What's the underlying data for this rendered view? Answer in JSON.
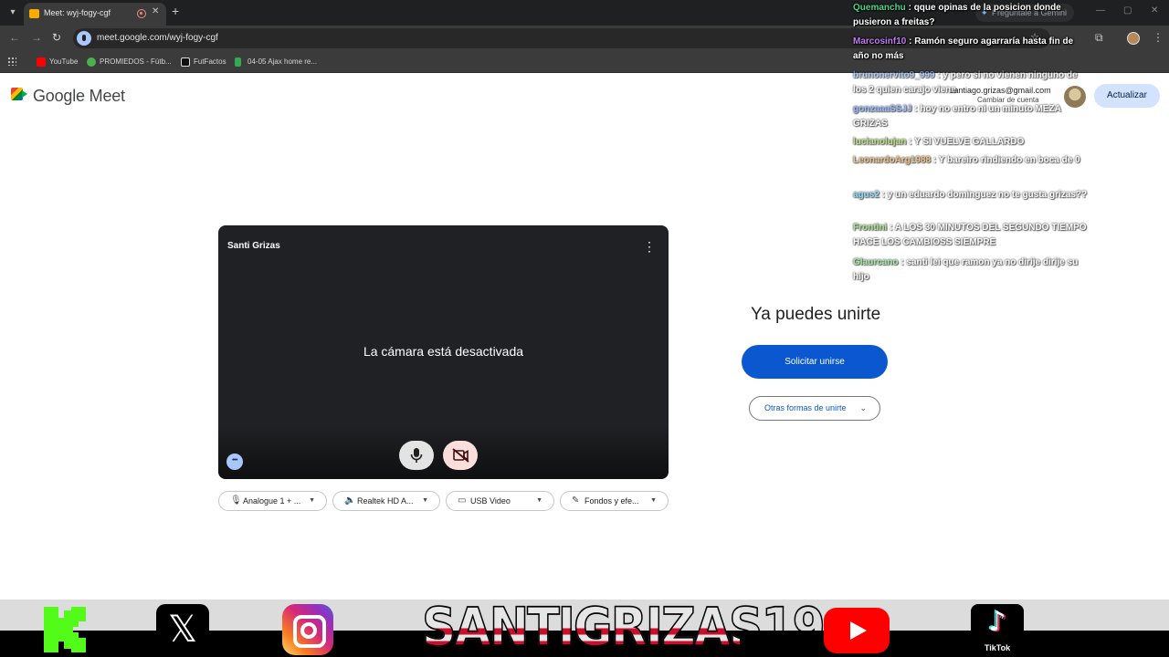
{
  "browser": {
    "tab_title": "Meet: wyj-fogy-cgf",
    "url": "meet.google.com/wyj-fogy-cgf",
    "profile_chip": "Pregúntale a Gemini",
    "bookmarks": [
      {
        "label": "YouTube",
        "color": "#ff0000"
      },
      {
        "label": "PROMIEDOS - Fútb...",
        "color": "#4caf50"
      },
      {
        "label": "FutFactos",
        "color": "#ffffff"
      },
      {
        "label": "04-05 Ajax home re...",
        "color": "#34a853"
      }
    ]
  },
  "header": {
    "brand": "Google Meet",
    "account_email": "santiago.grizas@gmail.com",
    "switch_account": "Cambiar de cuenta",
    "update_button": "Actualizar"
  },
  "preview": {
    "participant_name": "Santi Grizas",
    "camera_status": "La cámara está desactivada",
    "devices": [
      {
        "icon": "microphone-icon",
        "glyph": "🎙",
        "label": "Analogue 1 + ..."
      },
      {
        "icon": "speaker-icon",
        "glyph": "🔈",
        "label": "Realtek HD A..."
      },
      {
        "icon": "video-camera-icon",
        "glyph": "▭",
        "label": "USB Video"
      },
      {
        "icon": "effects-icon",
        "glyph": "✎",
        "label": "Fondos y efe..."
      }
    ]
  },
  "join_panel": {
    "title": "Ya puedes unirte",
    "join_button": "Solicitar unirse",
    "other_ways_button": "Otras formas de unirte"
  },
  "chat": {
    "messages": [
      {
        "user": "Quemanchu",
        "color": "#4dd68a",
        "text": "qque opinas de la posicion donde pusieron a freitas?",
        "faded": false
      },
      {
        "user": "Marcosinf10",
        "color": "#c27cf5",
        "text": "Ramón seguro agarraría hasta fin de año no más",
        "faded": false
      },
      {
        "user": "brunonervito9_999",
        "color": "#8ab4f8",
        "text": "y pero si no vienen ninguno de los 2 quien carajo viene",
        "faded": true
      },
      {
        "user": "gonzaaaSSJJ",
        "color": "#5b8cff",
        "text": "hoy no entro ni un minuto MEZA GRIZAS",
        "faded": true
      },
      {
        "user": "lucianolujan",
        "color": "#9acd32",
        "text": "Y SI VUELVE GALLARDO",
        "faded": true
      },
      {
        "user": "LeonardoArg1988",
        "color": "#e0a040",
        "text": "Y bareiro rindiendo en boca de 0",
        "faded": true
      },
      {
        "user": "agus2",
        "color": "#4fc3f7",
        "text": "y un eduardo dominguez no te gusta grizas??",
        "faded": true
      },
      {
        "user": "Frontini",
        "color": "#7cd64a",
        "text": "A LOS 30 MINUTOS DEL SEGUNDO TIEMPO HACE LOS CAMBIOSS SIEMPRE",
        "faded": true
      },
      {
        "user": "Glaurcano",
        "color": "#6ee06e",
        "text": "santi lei que ramon ya no dirije dirije su hijo",
        "faded": true
      }
    ]
  },
  "banner": {
    "channel_name": "SANTIGRIZAS19",
    "tiktok_label": "TikTok",
    "x_glyph": "𝕏"
  }
}
